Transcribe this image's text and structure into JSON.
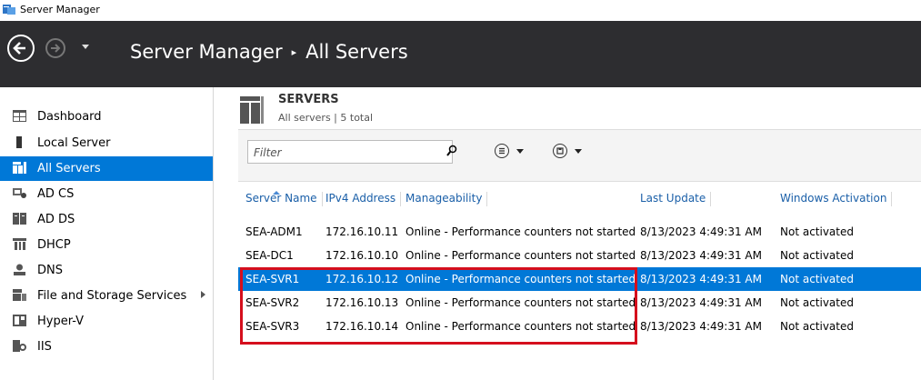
{
  "window": {
    "title": "Server Manager"
  },
  "header": {
    "app": "Server Manager",
    "page": "All Servers"
  },
  "sidebar": {
    "items": [
      {
        "label": "Dashboard",
        "icon": "dashboard-icon"
      },
      {
        "label": "Local Server",
        "icon": "server-icon"
      },
      {
        "label": "All Servers",
        "icon": "servers-icon",
        "active": true
      },
      {
        "label": "AD CS",
        "icon": "ad-cs-icon"
      },
      {
        "label": "AD DS",
        "icon": "ad-ds-icon"
      },
      {
        "label": "DHCP",
        "icon": "dhcp-icon"
      },
      {
        "label": "DNS",
        "icon": "dns-icon"
      },
      {
        "label": "File and Storage Services",
        "icon": "file-storage-icon",
        "expandable": true
      },
      {
        "label": "Hyper-V",
        "icon": "hyper-v-icon"
      },
      {
        "label": "IIS",
        "icon": "iis-icon"
      }
    ]
  },
  "servers": {
    "title": "SERVERS",
    "subtitle": "All servers | 5 total",
    "filter_placeholder": "Filter",
    "columns": [
      "Server Name",
      "IPv4 Address",
      "Manageability",
      "Last Update",
      "Windows Activation"
    ],
    "rows": [
      {
        "name": "SEA-ADM1",
        "ip": "172.16.10.11",
        "manageability": "Online - Performance counters not started",
        "last_update": "8/13/2023 4:49:31 AM",
        "activation": "Not activated"
      },
      {
        "name": "SEA-DC1",
        "ip": "172.16.10.10",
        "manageability": "Online - Performance counters not started",
        "last_update": "8/13/2023 4:49:31 AM",
        "activation": "Not activated"
      },
      {
        "name": "SEA-SVR1",
        "ip": "172.16.10.12",
        "manageability": "Online - Performance counters not started",
        "last_update": "8/13/2023 4:49:31 AM",
        "activation": "Not activated",
        "selected": true
      },
      {
        "name": "SEA-SVR2",
        "ip": "172.16.10.13",
        "manageability": "Online - Performance counters not started",
        "last_update": "8/13/2023 4:49:31 AM",
        "activation": "Not activated"
      },
      {
        "name": "SEA-SVR3",
        "ip": "172.16.10.14",
        "manageability": "Online - Performance counters not started",
        "last_update": "8/13/2023 4:49:31 AM",
        "activation": "Not activated"
      }
    ]
  },
  "colors": {
    "header_bg": "#2d2d30",
    "accent": "#0078d7",
    "highlight": "#d50f1d",
    "link": "#1a5fa8"
  }
}
